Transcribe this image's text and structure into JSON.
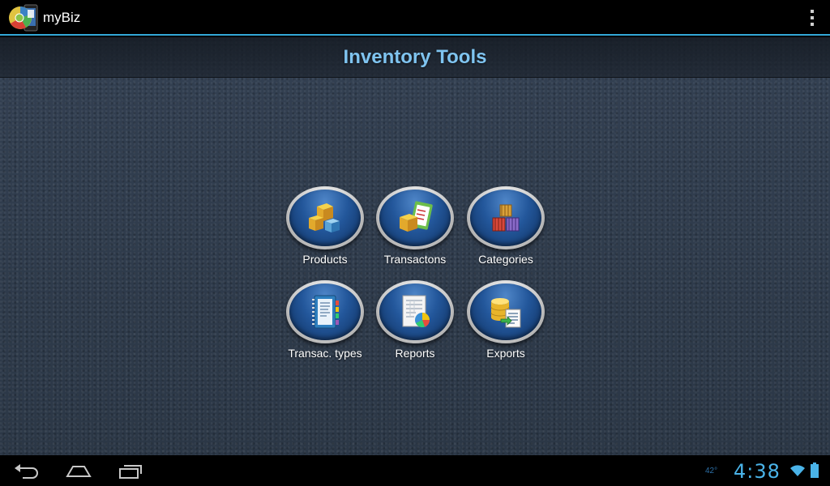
{
  "action_bar": {
    "app_title": "myBiz",
    "app_icon": "mybiz-app-icon",
    "overflow_icon": "overflow-menu-icon"
  },
  "page": {
    "title": "Inventory Tools"
  },
  "tools": [
    {
      "label": "Products",
      "icon": "products-boxes-icon"
    },
    {
      "label": "Transactons",
      "icon": "transactions-clipboard-icon"
    },
    {
      "label": "Categories",
      "icon": "categories-crates-icon"
    },
    {
      "label": "Transac. types",
      "icon": "transaction-types-notebook-icon"
    },
    {
      "label": "Reports",
      "icon": "reports-chart-icon"
    },
    {
      "label": "Exports",
      "icon": "exports-database-icon"
    }
  ],
  "nav_bar": {
    "back_icon": "back-icon",
    "home_icon": "home-icon",
    "recents_icon": "recent-apps-icon"
  },
  "status": {
    "temperature": "42°",
    "time": "4:38",
    "wifi_icon": "wifi-icon",
    "battery_icon": "battery-icon"
  },
  "colors": {
    "accent": "#33a8d8",
    "title": "#7fc4f0",
    "clock": "#4ab3e8",
    "background": "#2f3b4a"
  }
}
